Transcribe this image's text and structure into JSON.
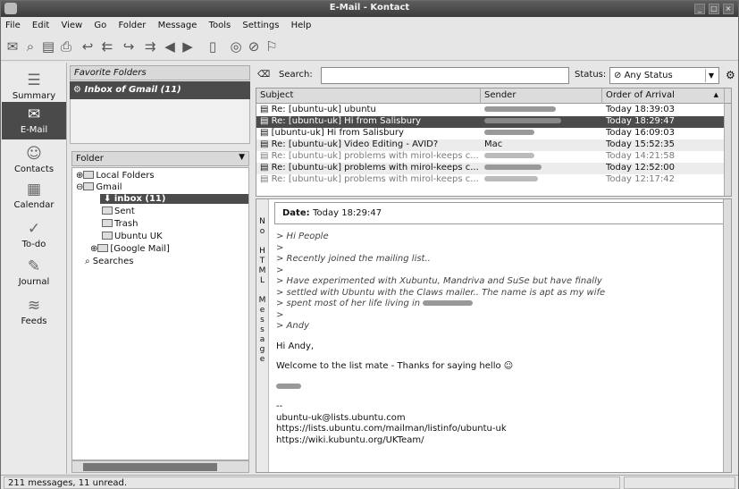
{
  "window": {
    "title": "E-Mail - Kontact"
  },
  "menu": [
    "File",
    "Edit",
    "View",
    "Go",
    "Folder",
    "Message",
    "Tools",
    "Settings",
    "Help"
  ],
  "toolbar_icons": [
    "new-mail-icon",
    "find-icon",
    "save-icon",
    "print-icon",
    "reply-icon",
    "reply-all-icon",
    "forward-icon",
    "back-icon",
    "next-icon",
    "trash-icon",
    "watch-icon",
    "ignore-icon",
    "spam-icon"
  ],
  "nav": [
    {
      "label": "Summary",
      "icon": "summary-icon",
      "active": false
    },
    {
      "label": "E-Mail",
      "icon": "mail-icon",
      "active": true
    },
    {
      "label": "Contacts",
      "icon": "contacts-icon",
      "active": false
    },
    {
      "label": "Calendar",
      "icon": "calendar-icon",
      "active": false
    },
    {
      "label": "To-do",
      "icon": "todo-icon",
      "active": false
    },
    {
      "label": "Journal",
      "icon": "journal-icon",
      "active": false
    },
    {
      "label": "Feeds",
      "icon": "feeds-icon",
      "active": false
    }
  ],
  "favorites": {
    "header": "Favorite Folders",
    "selected": "Inbox of Gmail  (11)"
  },
  "folders": {
    "header": "Folder",
    "items": [
      {
        "label": "Local Folders",
        "level": 0,
        "expander": "⊕",
        "selected": false
      },
      {
        "label": "Gmail",
        "level": 0,
        "expander": "⊖",
        "selected": false
      },
      {
        "label": "inbox (11)",
        "level": 2,
        "expander": "",
        "selected": true
      },
      {
        "label": "Sent",
        "level": 2,
        "expander": "",
        "selected": false
      },
      {
        "label": "Trash",
        "level": 2,
        "expander": "",
        "selected": false
      },
      {
        "label": "Ubuntu UK",
        "level": 2,
        "expander": "",
        "selected": false
      },
      {
        "label": "[Google Mail]",
        "level": 1,
        "expander": "⊕",
        "selected": false
      },
      {
        "label": "Searches",
        "level": 0,
        "expander": "",
        "selected": false
      }
    ]
  },
  "search": {
    "label": "Search:",
    "value": "",
    "status_label": "Status:",
    "status_value": "Any Status"
  },
  "columns": {
    "subject": "Subject",
    "sender": "Sender",
    "order": "Order of Arrival"
  },
  "messages": [
    {
      "subject": "Re: [ubuntu-uk] ubuntu",
      "sender": "",
      "time": "Today 18:39:03",
      "style": ""
    },
    {
      "subject": "Re: [ubuntu-uk] Hi from Salisbury",
      "sender": "",
      "time": "Today 18:29:47",
      "style": "sel"
    },
    {
      "subject": "[ubuntu-uk] Hi from Salisbury",
      "sender": "",
      "time": "Today 16:09:03",
      "style": ""
    },
    {
      "subject": "Re: [ubuntu-uk] Video Editing - AVID?",
      "sender": "Mac",
      "time": "Today 15:52:35",
      "style": "alt"
    },
    {
      "subject": "Re: [ubuntu-uk] problems with mirol-keeps c...",
      "sender": "",
      "time": "Today 14:21:58",
      "style": "dim"
    },
    {
      "subject": "Re: [ubuntu-uk] problems with mirol-keeps c...",
      "sender": "",
      "time": "Today 12:52:00",
      "style": "alt"
    },
    {
      "subject": "Re: [ubuntu-uk] problems with mirol-keeps c...",
      "sender": "",
      "time": "Today 12:17:42",
      "style": "dim"
    }
  ],
  "reading": {
    "vtab_chars": [
      "N",
      "o",
      "",
      "H",
      "T",
      "M",
      "L",
      "",
      "M",
      "e",
      "s",
      "s",
      "a",
      "g",
      "e"
    ],
    "date_label": "Date:",
    "date_value": "Today 18:29:47",
    "quoted": [
      "> Hi People",
      ">",
      "> Recently joined the mailing list..",
      ">",
      "> Have experimented with Xubuntu, Mandriva and SuSe but have finally",
      "> settled with Ubuntu with the Claws mailer.. The name is apt as my wife",
      "> spent most of her life living in",
      ">",
      "> Andy"
    ],
    "greeting": "Hi Andy,",
    "welcome": "Welcome to the list mate - Thanks for saying hello",
    "sig_dash": "--",
    "footer": [
      "ubuntu-uk@lists.ubuntu.com",
      "https://lists.ubuntu.com/mailman/listinfo/ubuntu-uk",
      "https://wiki.kubuntu.org/UKTeam/"
    ]
  },
  "statusbar": {
    "text": "211 messages, 11 unread."
  }
}
